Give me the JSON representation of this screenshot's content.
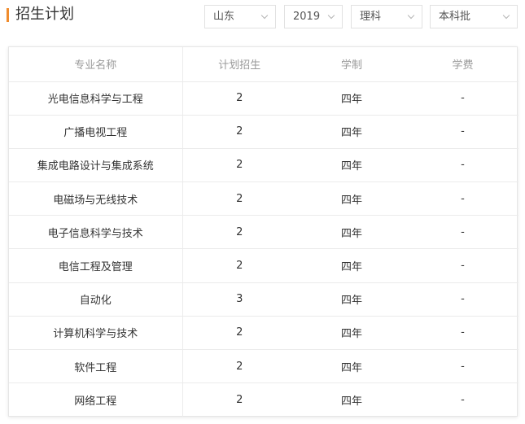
{
  "header": {
    "title": "招生计划",
    "filters": {
      "province": "山东",
      "year": "2019",
      "subject": "理科",
      "batch": "本科批"
    }
  },
  "table": {
    "columns": [
      "专业名称",
      "计划招生",
      "学制",
      "学费"
    ],
    "rows": [
      {
        "major": "光电信息科学与工程",
        "plan": "2",
        "duration": "四年",
        "fee": "-"
      },
      {
        "major": "广播电视工程",
        "plan": "2",
        "duration": "四年",
        "fee": "-"
      },
      {
        "major": "集成电路设计与集成系统",
        "plan": "2",
        "duration": "四年",
        "fee": "-"
      },
      {
        "major": "电磁场与无线技术",
        "plan": "2",
        "duration": "四年",
        "fee": "-"
      },
      {
        "major": "电子信息科学与技术",
        "plan": "2",
        "duration": "四年",
        "fee": "-"
      },
      {
        "major": "电信工程及管理",
        "plan": "2",
        "duration": "四年",
        "fee": "-"
      },
      {
        "major": "自动化",
        "plan": "3",
        "duration": "四年",
        "fee": "-"
      },
      {
        "major": "计算机科学与技术",
        "plan": "2",
        "duration": "四年",
        "fee": "-"
      },
      {
        "major": "软件工程",
        "plan": "2",
        "duration": "四年",
        "fee": "-"
      },
      {
        "major": "网络工程",
        "plan": "2",
        "duration": "四年",
        "fee": "-"
      }
    ]
  },
  "colors": {
    "accent": "#f08c2d",
    "header_text": "#9a9a9a",
    "border": "#ebebeb"
  },
  "icons": {
    "dropdown": "chevron-down-icon",
    "title_marker": "accent-bar"
  }
}
